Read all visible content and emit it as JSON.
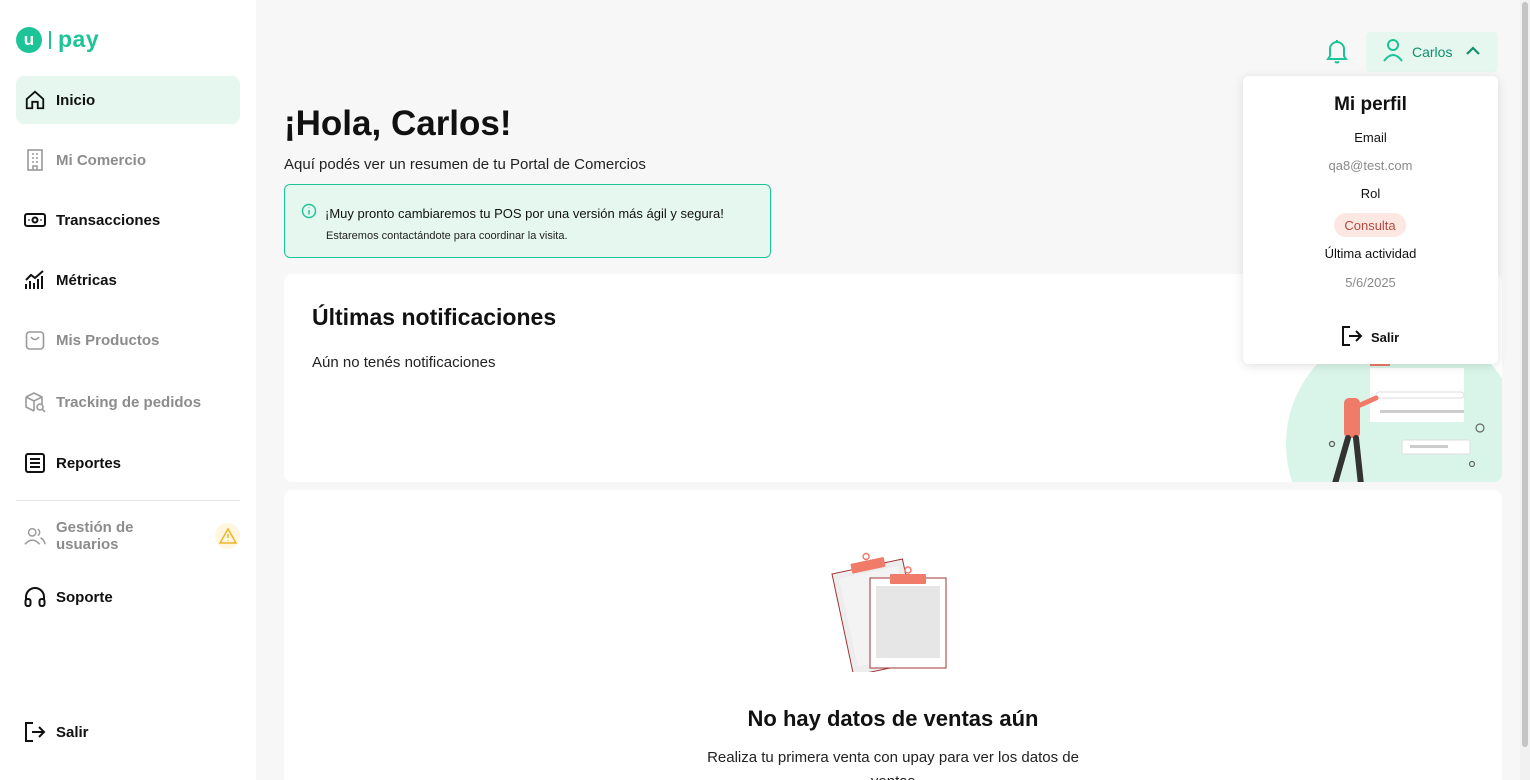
{
  "brand": {
    "logo_mark": "u",
    "logo_text": "pay",
    "color": "#1cc497"
  },
  "sidebar": {
    "items": [
      {
        "label": "Inicio",
        "icon": "home-icon",
        "active": true
      },
      {
        "label": "Mi Comercio",
        "icon": "building-icon",
        "muted": true
      },
      {
        "label": "Transacciones",
        "icon": "cash-icon"
      },
      {
        "label": "Métricas",
        "icon": "chart-icon"
      },
      {
        "label": "Mis Productos",
        "icon": "bag-icon",
        "muted": true
      },
      {
        "label": "Tracking de pedidos",
        "icon": "package-search-icon",
        "muted": true
      },
      {
        "label": "Reportes",
        "icon": "report-icon"
      },
      {
        "label": "Gestión de usuarios",
        "icon": "users-icon",
        "muted": true,
        "badge": "warning-icon"
      },
      {
        "label": "Soporte",
        "icon": "headset-icon"
      }
    ],
    "logout_label": "Salir"
  },
  "header": {
    "user_name": "Carlos"
  },
  "main": {
    "greeting": "¡Hola, Carlos!",
    "subtitle": "Aquí podés ver un resumen de tu Portal de Comercios",
    "alert": {
      "title": "¡Muy pronto cambiaremos tu POS por una versión más ágil y segura!",
      "description": "Estaremos contactándote para coordinar la visita."
    },
    "notifications": {
      "title": "Últimas notificaciones",
      "empty": "Aún no tenés notificaciones"
    },
    "sales": {
      "title": "No hay datos de ventas aún",
      "description": "Realiza tu primera venta con upay para ver los datos de ventas"
    }
  },
  "profile": {
    "title": "Mi perfil",
    "email_label": "Email",
    "email": "qa8@test.com",
    "role_label": "Rol",
    "role": "Consulta",
    "activity_label": "Última actividad",
    "activity": "5/6/2025",
    "logout_label": "Salir"
  }
}
